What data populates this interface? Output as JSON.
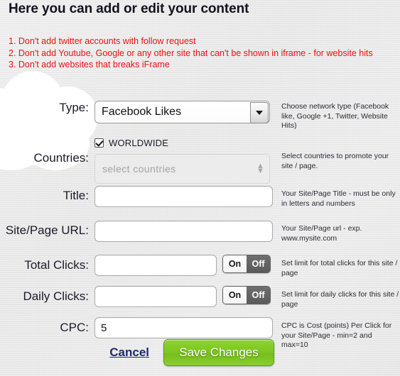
{
  "header": {
    "title": "Here you can add or edit your content",
    "notices": [
      "1. Don't add twitter accounts with follow request",
      "2. Don't add Youtube, Google or any other site that can't be shown in iframe - for website hits",
      "3. Don't add websites that breaks iFrame"
    ],
    "notice_color": "#ee1111"
  },
  "form": {
    "type": {
      "label": "Type:",
      "value": "Facebook Likes",
      "help": "Choose network type (Facebook like, Google +1, Twitter, Website Hits)"
    },
    "countries": {
      "label": "Countries:",
      "worldwide_label": "WORLDWIDE",
      "worldwide_checked": "true",
      "placeholder": "select countries",
      "help": "Select countries to promote your site / page."
    },
    "title": {
      "label": "Title:",
      "value": "",
      "placeholder": "",
      "help": "Your Site/Page Title - must be only in letters and numbers"
    },
    "site_url": {
      "label": "Site/Page URL:",
      "value": "",
      "placeholder": "",
      "help": "Your Site/Page url - exp. www.mysite.com"
    },
    "total_clicks": {
      "label": "Total Clicks:",
      "value": "",
      "placeholder": "",
      "toggle_on": "On",
      "toggle_off": "Off",
      "toggle_state": "Off",
      "help": "Set limit for total clicks for this site / page"
    },
    "daily_clicks": {
      "label": "Daily Clicks:",
      "value": "",
      "placeholder": "",
      "toggle_on": "On",
      "toggle_off": "Off",
      "toggle_state": "Off",
      "help": "Set limit for daily clicks for this site / page"
    },
    "cpc": {
      "label": "CPC:",
      "value": "5",
      "placeholder": "",
      "help": "CPC is Cost (points) Per Click for your Site/Page - min=2 and max=10"
    }
  },
  "actions": {
    "cancel_label": "Cancel",
    "save_label": "Save Changes",
    "save_color": "#7cc521",
    "cancel_color": "#1b2a6b"
  }
}
